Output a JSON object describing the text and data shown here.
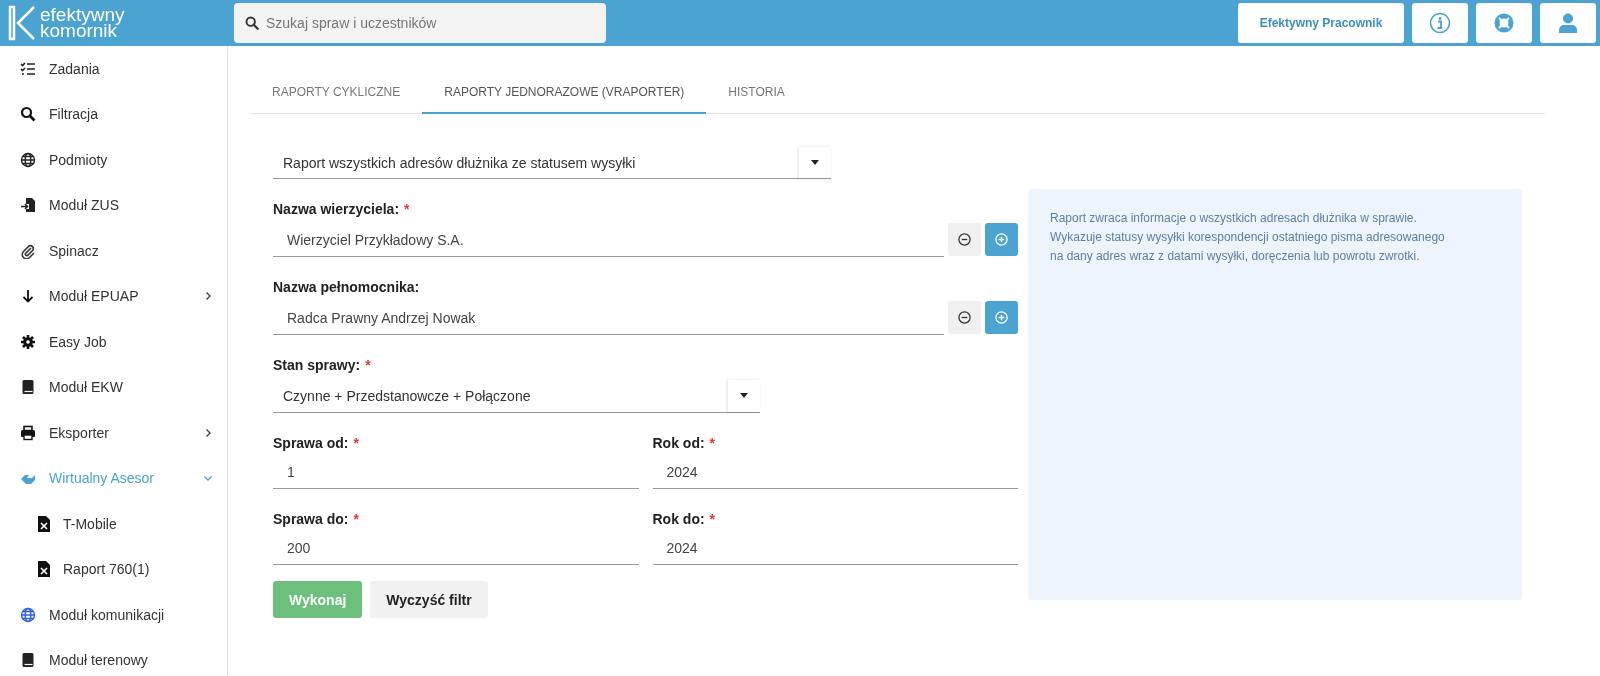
{
  "header": {
    "logo": {
      "line1": "efektywny",
      "line2": "komornik"
    },
    "search": {
      "placeholder": "Szukaj spraw i uczestników"
    },
    "user_button": "Efektywny Pracownik"
  },
  "sidebar": {
    "items": [
      {
        "label": "Zadania",
        "selected": false
      },
      {
        "label": "Filtracja",
        "selected": false
      },
      {
        "label": "Podmioty",
        "selected": false
      },
      {
        "label": "Moduł ZUS",
        "selected": false
      },
      {
        "label": "Spinacz",
        "selected": false
      },
      {
        "label": "Moduł EPUAP",
        "selected": false,
        "expanded": false
      },
      {
        "label": "Easy Job",
        "selected": false
      },
      {
        "label": "Moduł EKW",
        "selected": false
      },
      {
        "label": "Eksporter",
        "selected": false,
        "expanded": false
      },
      {
        "label": "Wirtualny Asesor",
        "selected": true,
        "expanded": true,
        "children": [
          {
            "label": "T-Mobile",
            "selected": false
          },
          {
            "label": "Raport 760(1)",
            "selected": false
          }
        ]
      },
      {
        "label": "Moduł komunikacji",
        "selected": false
      },
      {
        "label": "Moduł terenowy",
        "selected": false
      }
    ]
  },
  "tabs": [
    {
      "label": "RAPORTY CYKLICZNE",
      "selected": false
    },
    {
      "label": "RAPORTY JEDNORAZOWE (VRAPORTER)",
      "selected": true
    },
    {
      "label": "HISTORIA",
      "selected": false
    }
  ],
  "report_select": {
    "value": "Raport wszystkich adresów dłużnika ze statusem wysyłki"
  },
  "form": {
    "rows": [
      [
        {
          "kind": "lookup",
          "label": "Nazwa wierzyciela:",
          "mark": "*",
          "value": "Wierzyciel Przykładowy S.A."
        }
      ],
      [
        {
          "kind": "lookup",
          "label": "Nazwa pełnomocnika:",
          "value": "Radca Prawny Andrzej Nowak"
        }
      ],
      [
        {
          "kind": "select",
          "label": "Stan sprawy:",
          "mark": "*",
          "value": "Czynne + Przedstanowcze + Połączone"
        }
      ],
      [
        {
          "kind": "text",
          "label": "Sprawa od:",
          "mark": "*",
          "value": "1"
        },
        {
          "kind": "text",
          "label": "Rok od:",
          "mark": "*",
          "value": "2024"
        }
      ],
      [
        {
          "kind": "text",
          "label": "Sprawa do:",
          "mark": "*",
          "value": "200"
        },
        {
          "kind": "text",
          "label": "Rok do:",
          "mark": "*",
          "value": "2024"
        }
      ]
    ]
  },
  "buttons": [
    {
      "label": "Wykonaj",
      "kind": "primary"
    },
    {
      "label": "Wyczyść filtr",
      "kind": "secondary"
    }
  ],
  "info_panel": {
    "lines": [
      "Raport zwraca informacje o wszystkich adresach dłużnika w sprawie.",
      "Wykazuje statusy wysyłki korespondencji ostatniego pisma adresowanego",
      "na dany adres wraz z datami wysyłki, doręczenia lub powrotu zwrotki."
    ]
  }
}
